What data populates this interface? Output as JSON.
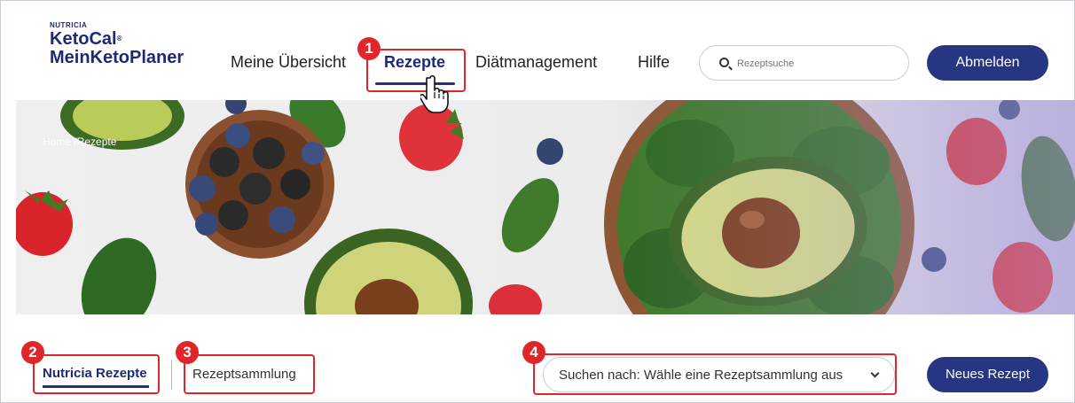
{
  "logo": {
    "brand": "NUTRICIA",
    "line1": "KetoCal",
    "line2": "MeinKetoPlaner"
  },
  "nav": {
    "items": [
      {
        "label": "Meine Übersicht"
      },
      {
        "label": "Rezepte"
      },
      {
        "label": "Diätmanagement"
      },
      {
        "label": "Hilfe"
      }
    ],
    "active": "Rezepte"
  },
  "search": {
    "placeholder": "Rezeptsuche"
  },
  "logout_label": "Abmelden",
  "breadcrumb": "Home /Rezepte",
  "tabs": [
    {
      "label": "Nutricia Rezepte"
    },
    {
      "label": "Rezeptsammlung"
    }
  ],
  "collection_select": {
    "value": "Suchen nach: Wähle eine Rezeptsammlung aus"
  },
  "new_recipe_label": "Neues Rezept",
  "markers": [
    "1",
    "2",
    "3",
    "4"
  ],
  "colors": {
    "accent": "#263683",
    "marker": "#e0262b"
  }
}
